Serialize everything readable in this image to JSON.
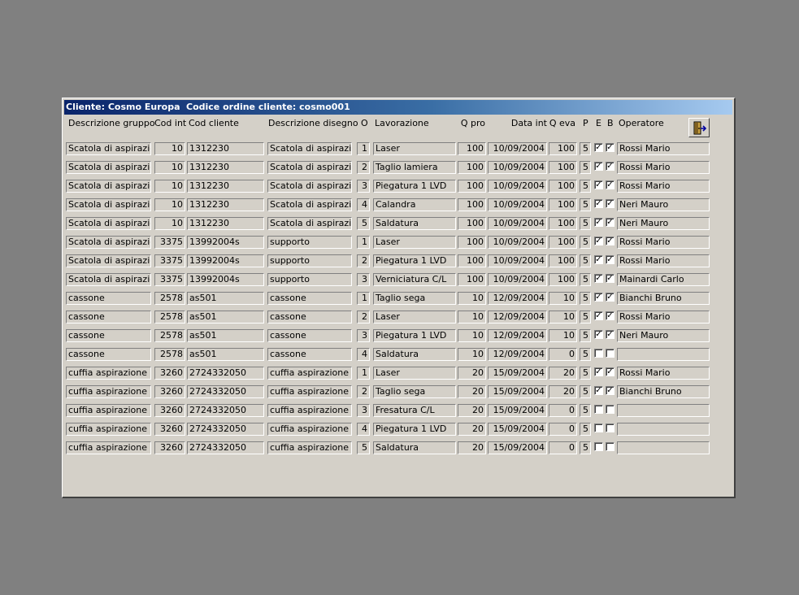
{
  "titlebar": {
    "cliente": "Cliente: Cosmo Europa",
    "codice": "Codice ordine cliente: cosmo001"
  },
  "headers": {
    "descrizione_gruppo": "Descrizione gruppo",
    "cod_int": "Cod int",
    "cod_cliente": "Cod cliente",
    "descrizione_disegno": "Descrizione disegno",
    "o": "O",
    "lavorazione": "Lavorazione",
    "q_pro": "Q pro",
    "data_int": "Data int",
    "q_eva": "Q eva",
    "p": "P",
    "e": "E",
    "b": "B",
    "operatore": "Operatore"
  },
  "exit_button": {
    "icon": "exit-door-icon"
  },
  "rows": [
    {
      "gruppo": "Scatola di aspirazione",
      "cod_int": "10",
      "cod_cliente": "1312230",
      "disegno": "Scatola di aspirazione",
      "o": "1",
      "lavorazione": "Laser",
      "q_pro": "100",
      "data_int": "10/09/2004",
      "q_eva": "100",
      "p": "5",
      "e": true,
      "b": true,
      "operatore": "Rossi Mario"
    },
    {
      "gruppo": "Scatola di aspirazione",
      "cod_int": "10",
      "cod_cliente": "1312230",
      "disegno": "Scatola di aspirazione",
      "o": "2",
      "lavorazione": "Taglio lamiera",
      "q_pro": "100",
      "data_int": "10/09/2004",
      "q_eva": "100",
      "p": "5",
      "e": true,
      "b": true,
      "operatore": "Rossi Mario"
    },
    {
      "gruppo": "Scatola di aspirazione",
      "cod_int": "10",
      "cod_cliente": "1312230",
      "disegno": "Scatola di aspirazione",
      "o": "3",
      "lavorazione": "Piegatura 1 LVD",
      "q_pro": "100",
      "data_int": "10/09/2004",
      "q_eva": "100",
      "p": "5",
      "e": true,
      "b": true,
      "operatore": "Rossi Mario"
    },
    {
      "gruppo": "Scatola di aspirazione",
      "cod_int": "10",
      "cod_cliente": "1312230",
      "disegno": "Scatola di aspirazione",
      "o": "4",
      "lavorazione": "Calandra",
      "q_pro": "100",
      "data_int": "10/09/2004",
      "q_eva": "100",
      "p": "5",
      "e": true,
      "b": true,
      "operatore": "Neri Mauro"
    },
    {
      "gruppo": "Scatola di aspirazione",
      "cod_int": "10",
      "cod_cliente": "1312230",
      "disegno": "Scatola di aspirazione",
      "o": "5",
      "lavorazione": "Saldatura",
      "q_pro": "100",
      "data_int": "10/09/2004",
      "q_eva": "100",
      "p": "5",
      "e": true,
      "b": true,
      "operatore": "Neri Mauro"
    },
    {
      "gruppo": "Scatola di aspirazione",
      "cod_int": "3375",
      "cod_cliente": "13992004s",
      "disegno": "supporto",
      "o": "1",
      "lavorazione": "Laser",
      "q_pro": "100",
      "data_int": "10/09/2004",
      "q_eva": "100",
      "p": "5",
      "e": true,
      "b": true,
      "operatore": "Rossi Mario"
    },
    {
      "gruppo": "Scatola di aspirazione",
      "cod_int": "3375",
      "cod_cliente": "13992004s",
      "disegno": "supporto",
      "o": "2",
      "lavorazione": "Piegatura 1 LVD",
      "q_pro": "100",
      "data_int": "10/09/2004",
      "q_eva": "100",
      "p": "5",
      "e": true,
      "b": true,
      "operatore": "Rossi Mario"
    },
    {
      "gruppo": "Scatola di aspirazione",
      "cod_int": "3375",
      "cod_cliente": "13992004s",
      "disegno": "supporto",
      "o": "3",
      "lavorazione": "Verniciatura C/L",
      "q_pro": "100",
      "data_int": "10/09/2004",
      "q_eva": "100",
      "p": "5",
      "e": true,
      "b": true,
      "operatore": "Mainardi Carlo"
    },
    {
      "gruppo": "cassone",
      "cod_int": "2578",
      "cod_cliente": "as501",
      "disegno": "cassone",
      "o": "1",
      "lavorazione": "Taglio sega",
      "q_pro": "10",
      "data_int": "12/09/2004",
      "q_eva": "10",
      "p": "5",
      "e": true,
      "b": true,
      "operatore": "Bianchi Bruno"
    },
    {
      "gruppo": "cassone",
      "cod_int": "2578",
      "cod_cliente": "as501",
      "disegno": "cassone",
      "o": "2",
      "lavorazione": "Laser",
      "q_pro": "10",
      "data_int": "12/09/2004",
      "q_eva": "10",
      "p": "5",
      "e": true,
      "b": true,
      "operatore": "Rossi Mario"
    },
    {
      "gruppo": "cassone",
      "cod_int": "2578",
      "cod_cliente": "as501",
      "disegno": "cassone",
      "o": "3",
      "lavorazione": "Piegatura 1 LVD",
      "q_pro": "10",
      "data_int": "12/09/2004",
      "q_eva": "10",
      "p": "5",
      "e": true,
      "b": true,
      "operatore": "Neri Mauro"
    },
    {
      "gruppo": "cassone",
      "cod_int": "2578",
      "cod_cliente": "as501",
      "disegno": "cassone",
      "o": "4",
      "lavorazione": "Saldatura",
      "q_pro": "10",
      "data_int": "12/09/2004",
      "q_eva": "0",
      "p": "5",
      "e": false,
      "b": false,
      "operatore": ""
    },
    {
      "gruppo": "cuffia aspirazione",
      "cod_int": "3260",
      "cod_cliente": "2724332050",
      "disegno": "cuffia aspirazione",
      "o": "1",
      "lavorazione": "Laser",
      "q_pro": "20",
      "data_int": "15/09/2004",
      "q_eva": "20",
      "p": "5",
      "e": true,
      "b": true,
      "operatore": "Rossi Mario"
    },
    {
      "gruppo": "cuffia aspirazione",
      "cod_int": "3260",
      "cod_cliente": "2724332050",
      "disegno": "cuffia aspirazione",
      "o": "2",
      "lavorazione": "Taglio sega",
      "q_pro": "20",
      "data_int": "15/09/2004",
      "q_eva": "20",
      "p": "5",
      "e": true,
      "b": true,
      "operatore": "Bianchi Bruno"
    },
    {
      "gruppo": "cuffia aspirazione",
      "cod_int": "3260",
      "cod_cliente": "2724332050",
      "disegno": "cuffia aspirazione",
      "o": "3",
      "lavorazione": "Fresatura C/L",
      "q_pro": "20",
      "data_int": "15/09/2004",
      "q_eva": "0",
      "p": "5",
      "e": false,
      "b": false,
      "operatore": ""
    },
    {
      "gruppo": "cuffia aspirazione",
      "cod_int": "3260",
      "cod_cliente": "2724332050",
      "disegno": "cuffia aspirazione",
      "o": "4",
      "lavorazione": "Piegatura 1 LVD",
      "q_pro": "20",
      "data_int": "15/09/2004",
      "q_eva": "0",
      "p": "5",
      "e": false,
      "b": false,
      "operatore": ""
    },
    {
      "gruppo": "cuffia aspirazione",
      "cod_int": "3260",
      "cod_cliente": "2724332050",
      "disegno": "cuffia aspirazione",
      "o": "5",
      "lavorazione": "Saldatura",
      "q_pro": "20",
      "data_int": "15/09/2004",
      "q_eva": "0",
      "p": "5",
      "e": false,
      "b": false,
      "operatore": ""
    }
  ]
}
